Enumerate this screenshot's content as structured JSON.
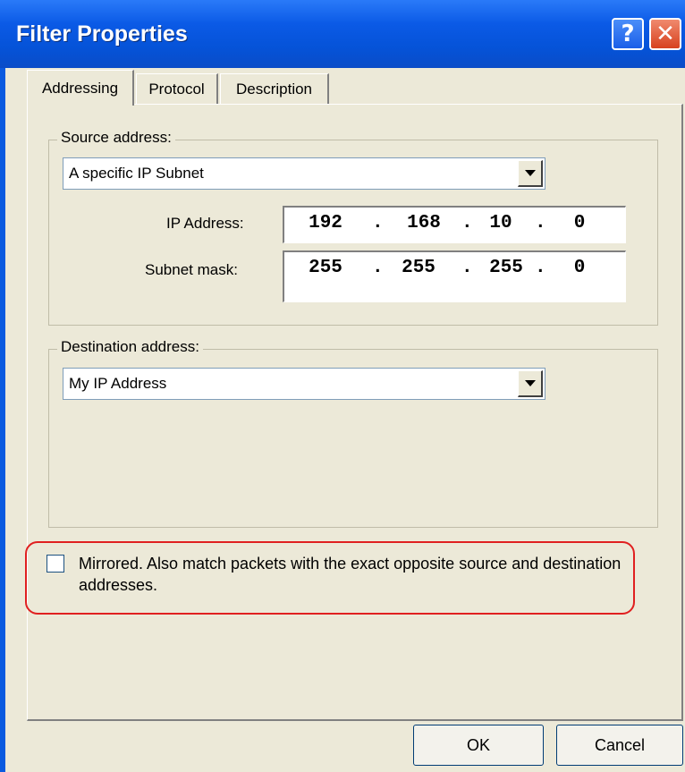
{
  "window": {
    "title": "Filter Properties"
  },
  "titlebar": {
    "help_glyph": "?",
    "close_glyph": "✕"
  },
  "tabs": [
    {
      "label": "Addressing",
      "active": true
    },
    {
      "label": "Protocol",
      "active": false
    },
    {
      "label": "Description",
      "active": false
    }
  ],
  "source": {
    "legend": "Source address:",
    "selected": "A specific IP Subnet",
    "ip_label": "IP Address:",
    "ip_octets": [
      "192",
      "168",
      "10",
      "0"
    ],
    "mask_label": "Subnet mask:",
    "mask_octets": [
      "255",
      "255",
      "255",
      "0"
    ]
  },
  "destination": {
    "legend": "Destination address:",
    "selected": "My IP Address"
  },
  "mirrored": {
    "checked": false,
    "label": "Mirrored. Also match packets with the exact opposite source and destination addresses."
  },
  "buttons": {
    "ok": "OK",
    "cancel": "Cancel"
  },
  "colors": {
    "titlebar": "#0553d8",
    "dialog_bg": "#ece9d8",
    "highlight": "#e02020"
  },
  "icons": {
    "help": "help-icon",
    "close": "close-icon",
    "dropdown": "chevron-down-icon"
  }
}
